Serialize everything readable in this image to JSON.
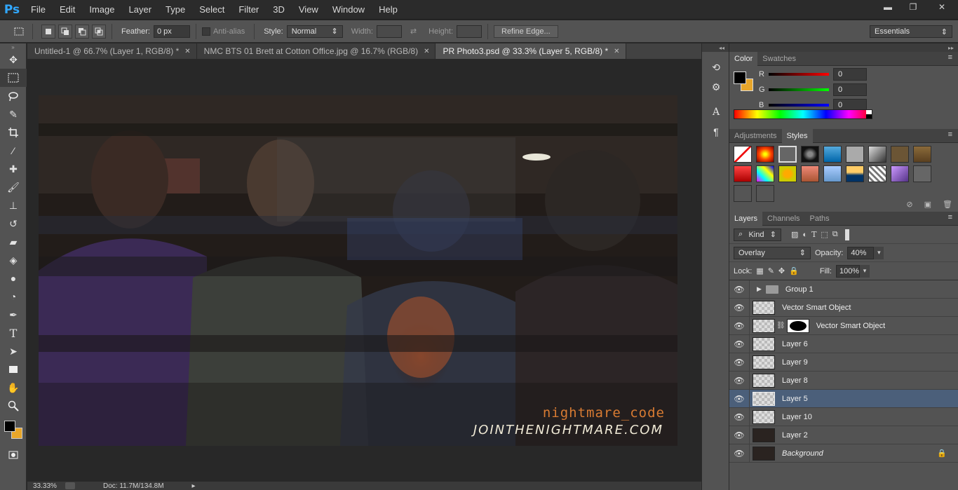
{
  "app": {
    "logo": "Ps"
  },
  "menu": [
    "File",
    "Edit",
    "Image",
    "Layer",
    "Type",
    "Select",
    "Filter",
    "3D",
    "View",
    "Window",
    "Help"
  ],
  "window_controls": {
    "minimize": "▬",
    "restore": "❐",
    "close": "✕"
  },
  "options": {
    "feather_label": "Feather:",
    "feather_value": "0 px",
    "antialias_label": "Anti-alias",
    "style_label": "Style:",
    "style_value": "Normal",
    "width_label": "Width:",
    "height_label": "Height:",
    "refine_edge": "Refine Edge...",
    "workspace": "Essentials"
  },
  "tabs": [
    {
      "label": "Untitled-1 @ 66.7% (Layer 1, RGB/8) *",
      "close": "✕"
    },
    {
      "label": "NMC BTS 01 Brett at Cotton Office.jpg @ 16.7% (RGB/8)",
      "close": "✕"
    },
    {
      "label": "PR Photo3.psd @ 33.3% (Layer 5, RGB/8) *",
      "close": "✕"
    }
  ],
  "artwork": {
    "text_line1": "nightmare_code",
    "text_line2": "JOINTHENIGHTMARE.COM"
  },
  "status": {
    "zoom": "33.33%",
    "doc": "Doc: 11.7M/134.8M"
  },
  "color_panel": {
    "tabs": [
      "Color",
      "Swatches"
    ],
    "r_label": "R",
    "g_label": "G",
    "b_label": "B",
    "r_value": "0",
    "g_value": "0",
    "b_value": "0",
    "foreground": "#000000",
    "background": "#e8a62a"
  },
  "styles_panel": {
    "tabs": [
      "Adjustments",
      "Styles"
    ]
  },
  "layers_panel": {
    "tabs": [
      "Layers",
      "Channels",
      "Paths"
    ],
    "filter_kind": "Kind",
    "blend_mode": "Overlay",
    "opacity_label": "Opacity:",
    "opacity_value": "40%",
    "lock_label": "Lock:",
    "fill_label": "Fill:",
    "fill_value": "100%",
    "layers": [
      {
        "name": "Group 1",
        "type": "group"
      },
      {
        "name": "Vector Smart Object",
        "type": "smart"
      },
      {
        "name": "Vector Smart Object",
        "type": "smart-mask"
      },
      {
        "name": "Layer 6",
        "type": "layer"
      },
      {
        "name": "Layer 9",
        "type": "layer"
      },
      {
        "name": "Layer 8",
        "type": "layer"
      },
      {
        "name": "Layer 5",
        "type": "layer",
        "selected": true
      },
      {
        "name": "Layer 10",
        "type": "layer"
      },
      {
        "name": "Layer 2",
        "type": "layer"
      },
      {
        "name": "Background",
        "type": "background"
      }
    ]
  },
  "panel_menu_icon": "≡"
}
